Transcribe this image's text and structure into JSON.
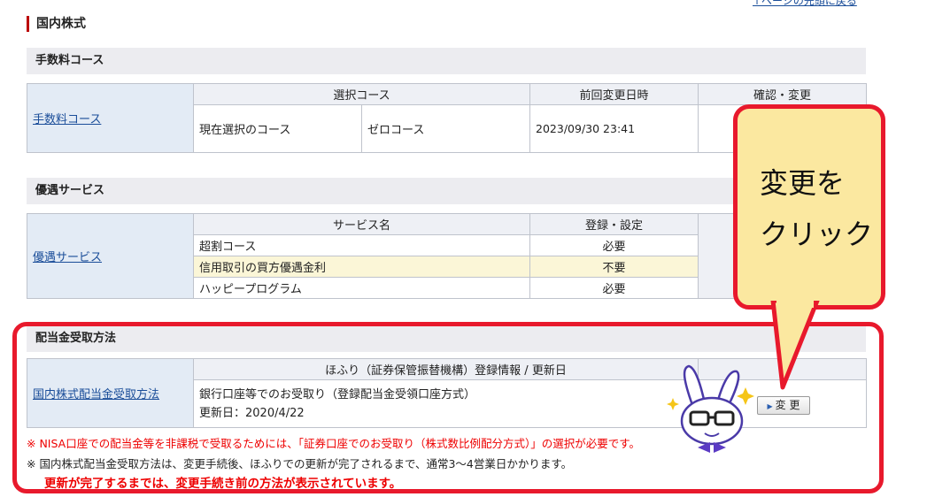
{
  "top_link": "↑ページの先頭に戻る",
  "page_title": "国内株式",
  "fee": {
    "section": "手数料コース",
    "side": "手数料コース",
    "headers": [
      "選択コース",
      "前回変更日時",
      "確認・変更"
    ],
    "row_label": "現在選択のコース",
    "course": "ゼロコース",
    "date": "2023/09/30 23:41"
  },
  "benefit": {
    "section": "優遇サービス",
    "side": "優遇サービス",
    "headers": [
      "サービス名",
      "登録・設定"
    ],
    "rows": [
      {
        "name": "超割コース",
        "status": "必要"
      },
      {
        "name": "信用取引の買方優遇金利",
        "status": "不要"
      },
      {
        "name": "ハッピープログラム",
        "status": "必要"
      }
    ]
  },
  "dividend": {
    "section": "配当金受取方法",
    "side": "国内株式配当金受取方法",
    "header": "ほふり（証券保管振替機構）登録情報 / 更新日",
    "method": "銀行口座等でのお受取り（登録配当金受領口座方式）",
    "updated": "更新日：2020/4/22",
    "button": "変 更"
  },
  "notes": {
    "red": "※ NISA口座での配当金等を非課税で受取るためには、「証券口座でのお受取り（株式数比例配分方式）」の選択が必要です。",
    "normal": "※ 国内株式配当金受取方法は、変更手続後、ほふりでの更新が完了されるまで、通常3〜4営業日かかります。",
    "bold": "更新が完了するまでは、変更手続き前の方法が表示されています。"
  },
  "callout": {
    "line1": "変更を",
    "line2": "クリック"
  },
  "colors": {
    "accent_red": "#e8192c",
    "callout_bg": "#fbe8a0",
    "link": "#1a4d99"
  }
}
